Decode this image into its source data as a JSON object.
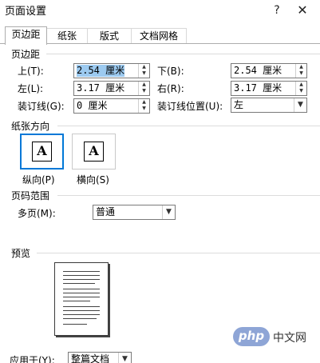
{
  "window": {
    "title": "页面设置",
    "help": "?",
    "close": "✕"
  },
  "tabs": [
    {
      "label": "页边距",
      "active": true
    },
    {
      "label": "纸张",
      "active": false
    },
    {
      "label": "版式",
      "active": false
    },
    {
      "label": "文档网格",
      "active": false
    }
  ],
  "margins": {
    "group_title": "页边距",
    "top_label": "上(T):",
    "top_value": "2.54 厘米",
    "bottom_label": "下(B):",
    "bottom_value": "2.54 厘米",
    "left_label": "左(L):",
    "left_value": "3.17 厘米",
    "right_label": "右(R):",
    "right_value": "3.17 厘米",
    "gutter_label": "装订线(G):",
    "gutter_value": "0 厘米",
    "gutter_pos_label": "装订线位置(U):",
    "gutter_pos_value": "左"
  },
  "orientation": {
    "group_title": "纸张方向",
    "portrait_label": "纵向(P)",
    "landscape_label": "横向(S)",
    "icon_glyph": "A",
    "selected": "portrait"
  },
  "pages": {
    "group_title": "页码范围",
    "multi_label": "多页(M):",
    "multi_value": "普通"
  },
  "preview": {
    "group_title": "预览",
    "apply_label": "应用于(Y):",
    "apply_value": "整篇文档"
  },
  "watermark": {
    "logo": "php",
    "site": "中文网"
  },
  "colors": {
    "accent": "#0078d7",
    "selection": "#9ccaf0"
  }
}
